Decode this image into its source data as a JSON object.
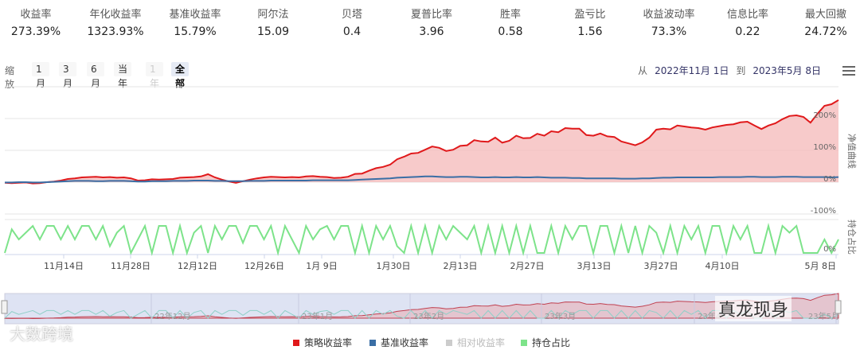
{
  "stats": [
    {
      "label": "收益率",
      "value": "273.39%"
    },
    {
      "label": "年化收益率",
      "value": "1323.93%"
    },
    {
      "label": "基准收益率",
      "value": "15.79%"
    },
    {
      "label": "阿尔法",
      "value": "15.09"
    },
    {
      "label": "贝塔",
      "value": "0.4"
    },
    {
      "label": "夏普比率",
      "value": "3.96"
    },
    {
      "label": "胜率",
      "value": "0.58"
    },
    {
      "label": "盈亏比",
      "value": "1.56"
    },
    {
      "label": "收益波动率",
      "value": "73.3%"
    },
    {
      "label": "信息比率",
      "value": "0.22"
    },
    {
      "label": "最大回撤",
      "value": "24.72%"
    }
  ],
  "zoom": {
    "label": "缩放",
    "buttons": [
      {
        "label": "1月",
        "state": "normal"
      },
      {
        "label": "3月",
        "state": "normal"
      },
      {
        "label": "6月",
        "state": "normal"
      },
      {
        "label": "当年",
        "state": "normal"
      },
      {
        "label": "1年",
        "state": "disabled"
      },
      {
        "label": "全部",
        "state": "active"
      }
    ]
  },
  "range": {
    "from_label": "从",
    "from": "2022年11月 1日",
    "to_label": "到",
    "to": "2023年5月 8日"
  },
  "menu_icon": "hamburger-menu-icon",
  "watermarks": {
    "left": "大数跨境",
    "right": "真龙现身"
  },
  "colors": {
    "strategy": "#e0191b",
    "benchmark": "#3a6ea5",
    "relative": "#cccccc",
    "position": "#7de38a",
    "strategy_fill": "#f4b8b8",
    "navigator_bg": "#d6dcf0"
  },
  "chart_data": [
    {
      "type": "area",
      "axis_title": "净值曲线",
      "y_ticks": [
        "200%",
        "100%",
        "0%",
        "-100%"
      ],
      "ylim": [
        -100,
        250
      ],
      "x_tick_labels": [
        "11月14日",
        "11月28日",
        "12月12日",
        "12月26日",
        "1月 9日",
        "1月30日",
        "2月13日",
        "2月27日",
        "3月13日",
        "3月27日",
        "4月10日",
        "5月 8日"
      ],
      "series": [
        {
          "name": "策略收益率",
          "values": [
            -2,
            -3,
            -2,
            -1,
            -4,
            -3,
            0,
            2,
            5,
            10,
            12,
            15,
            16,
            17,
            15,
            16,
            14,
            15,
            12,
            5,
            6,
            9,
            8,
            9,
            10,
            14,
            15,
            16,
            18,
            25,
            15,
            8,
            2,
            -2,
            3,
            8,
            12,
            15,
            17,
            16,
            15,
            16,
            15,
            18,
            19,
            17,
            16,
            13,
            14,
            17,
            26,
            27,
            36,
            44,
            48,
            55,
            72,
            80,
            90,
            92,
            102,
            112,
            108,
            98,
            102,
            114,
            116,
            132,
            128,
            127,
            140,
            124,
            130,
            146,
            138,
            139,
            152,
            146,
            160,
            157,
            170,
            168,
            168,
            148,
            146,
            153,
            144,
            142,
            128,
            122,
            116,
            125,
            140,
            165,
            168,
            166,
            178,
            175,
            172,
            170,
            165,
            172,
            176,
            180,
            182,
            188,
            190,
            178,
            167,
            178,
            185,
            198,
            208,
            210,
            205,
            187,
            215,
            240,
            245,
            258
          ]
        },
        {
          "name": "基准收益率",
          "values": [
            -1,
            -1,
            0,
            0,
            -1,
            -1,
            0,
            1,
            2,
            3,
            4,
            4,
            4,
            3,
            3,
            4,
            4,
            4,
            3,
            2,
            2,
            3,
            3,
            3,
            4,
            4,
            4,
            5,
            5,
            5,
            4,
            4,
            3,
            3,
            3,
            4,
            4,
            4,
            5,
            5,
            5,
            5,
            5,
            5,
            6,
            6,
            6,
            6,
            6,
            6,
            7,
            8,
            9,
            10,
            11,
            12,
            14,
            15,
            16,
            17,
            18,
            18,
            17,
            16,
            16,
            17,
            17,
            16,
            15,
            15,
            16,
            15,
            15,
            16,
            15,
            15,
            16,
            15,
            14,
            14,
            14,
            13,
            13,
            12,
            12,
            12,
            12,
            12,
            11,
            11,
            11,
            12,
            12,
            13,
            14,
            14,
            15,
            15,
            15,
            15,
            15,
            15,
            16,
            16,
            16,
            16,
            17,
            17,
            16,
            16,
            16,
            17,
            17,
            17,
            16,
            16,
            16,
            16,
            15,
            16
          ]
        }
      ]
    },
    {
      "type": "line",
      "axis_title": "持仓占比",
      "y_ticks": [
        "0%"
      ],
      "series": [
        {
          "name": "持仓占比",
          "values": [
            0,
            70,
            40,
            60,
            80,
            40,
            80,
            80,
            40,
            80,
            40,
            80,
            80,
            40,
            80,
            20,
            60,
            80,
            0,
            40,
            80,
            0,
            80,
            80,
            0,
            80,
            0,
            60,
            80,
            0,
            80,
            40,
            80,
            80,
            30,
            80,
            80,
            40,
            80,
            0,
            80,
            40,
            0,
            80,
            40,
            70,
            80,
            40,
            80,
            80,
            0,
            80,
            0,
            80,
            40,
            80,
            20,
            0,
            80,
            0,
            80,
            0,
            80,
            40,
            80,
            60,
            40,
            80,
            0,
            80,
            0,
            80,
            0,
            80,
            0,
            80,
            0,
            0,
            80,
            0,
            80,
            40,
            80,
            80,
            0,
            80,
            80,
            0,
            80,
            0,
            80,
            0,
            80,
            60,
            0,
            80,
            0,
            80,
            40,
            80,
            0,
            80,
            80,
            0,
            80,
            40,
            80,
            0,
            0,
            80,
            0,
            80,
            60,
            80,
            0,
            0,
            0,
            40,
            0,
            40
          ]
        }
      ]
    }
  ],
  "legend": [
    {
      "name": "策略收益率",
      "color": "#e0191b",
      "dim": false
    },
    {
      "name": "基准收益率",
      "color": "#3a6ea5",
      "dim": false
    },
    {
      "name": "相对收益率",
      "color": "#cccccc",
      "dim": true
    },
    {
      "name": "持仓占比",
      "color": "#7de38a",
      "dim": false
    }
  ],
  "navigator": {
    "labels": [
      "22年12月",
      "23年1月",
      "23年2月",
      "23年3月",
      "23年4",
      "23年5月"
    ]
  }
}
